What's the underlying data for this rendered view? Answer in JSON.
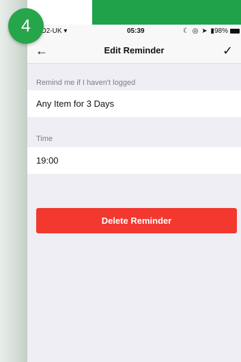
{
  "step_number": "4",
  "status_bar": {
    "carrier": "O2-UK ▾",
    "time": "05:39",
    "icons": "☾ ◎ ➤ ▮",
    "battery": "98%"
  },
  "nav": {
    "back_glyph": "←",
    "title": "Edit Reminder",
    "confirm_glyph": "✓"
  },
  "remind_section": {
    "label": "Remind me if I haven't logged",
    "value": "Any Item for 3 Days"
  },
  "time_section": {
    "label": "Time",
    "value": "19:00"
  },
  "delete_label": "Delete Reminder",
  "colors": {
    "badge": "#27a54b",
    "delete": "#f2382f",
    "background": "#efeef4"
  }
}
